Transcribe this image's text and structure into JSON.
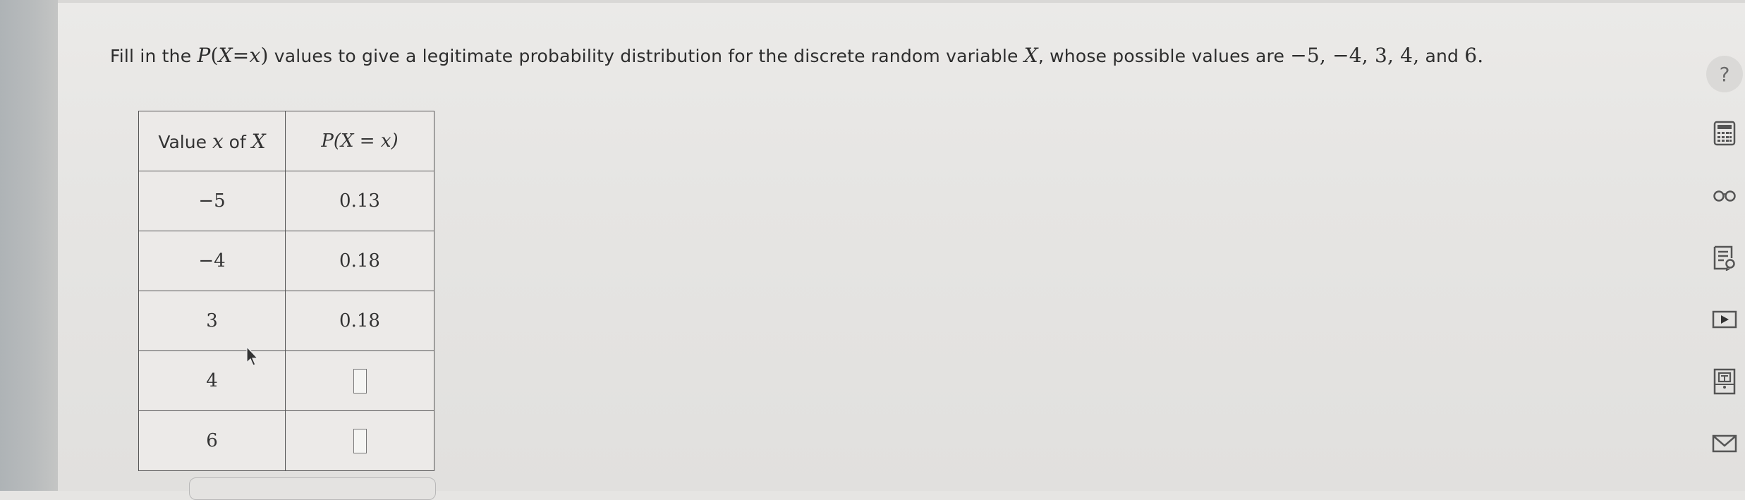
{
  "question": {
    "part1": "Fill in the ",
    "part2": " values to give a legitimate probability distribution for the discrete random variable ",
    "var": "X",
    "part3": ", whose possible values are ",
    "values_text": "−5, −4, 3, 4,",
    "and": " and ",
    "last_value": "6."
  },
  "table": {
    "header_value_prefix": "Value ",
    "header_value_x": "x",
    "header_value_of": " of ",
    "header_value_X": "X",
    "header_prob": "P(X = x)",
    "rows": [
      {
        "x": "−5",
        "p": "0.13"
      },
      {
        "x": "−4",
        "p": "0.18"
      },
      {
        "x": "3",
        "p": "0.18"
      },
      {
        "x": "4",
        "p": ""
      },
      {
        "x": "6",
        "p": ""
      }
    ]
  },
  "sidebar": {
    "help_label": "?",
    "icons": [
      "calculator-icon",
      "glasses-icon",
      "notes-icon",
      "video-icon",
      "textbook-icon",
      "mail-icon"
    ]
  }
}
